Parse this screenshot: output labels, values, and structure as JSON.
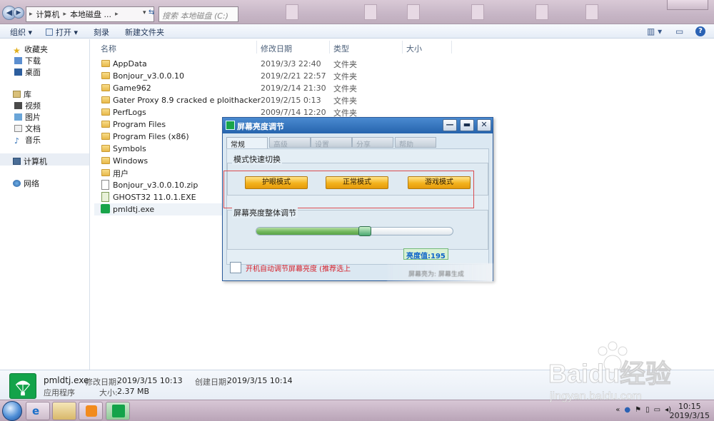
{
  "explorer": {
    "address_parts": [
      "计算机",
      "本地磁盘 ..."
    ],
    "search_placeholder": "搜索 本地磁盘 (C:)",
    "toolbar": {
      "organize": "组织 ▾",
      "open": "打开 ▾",
      "burn": "刻录",
      "new_folder": "新建文件夹"
    },
    "sidebar": {
      "favorites": "收藏夹",
      "downloads": "下载",
      "desktop": "桌面",
      "libraries": "库",
      "videos": "视频",
      "pictures": "图片",
      "documents": "文档",
      "music": "音乐",
      "computer": "计算机",
      "network": "网络"
    },
    "columns": {
      "name": "名称",
      "date": "修改日期",
      "type": "类型",
      "size": "大小"
    },
    "files": [
      {
        "name": "AppData",
        "date": "2019/3/3 22:40",
        "type": "文件夹"
      },
      {
        "name": "Bonjour_v3.0.0.10",
        "date": "2019/2/21 22:57",
        "type": "文件夹"
      },
      {
        "name": "Game962",
        "date": "2019/2/14 21:30",
        "type": "文件夹"
      },
      {
        "name": "Gater Proxy 8.9 cracked e ploithacker",
        "date": "2019/2/15 0:13",
        "type": "文件夹"
      },
      {
        "name": "PerfLogs",
        "date": "2009/7/14 12:20",
        "type": "文件夹"
      },
      {
        "name": "Program Files",
        "date": "",
        "type": ""
      },
      {
        "name": "Program Files (x86)",
        "date": "",
        "type": ""
      },
      {
        "name": "Symbols",
        "date": "",
        "type": ""
      },
      {
        "name": "Windows",
        "date": "",
        "type": ""
      },
      {
        "name": "用户",
        "date": "",
        "type": ""
      },
      {
        "name": "Bonjour_v3.0.0.10.zip",
        "date": "",
        "type": ""
      },
      {
        "name": "GHOST32 11.0.1.EXE",
        "date": "",
        "type": ""
      },
      {
        "name": "pmldtj.exe",
        "date": "",
        "type": ""
      }
    ],
    "details": {
      "filename": "pmldtj.exe",
      "modified_label": "修改日期:",
      "modified": "2019/3/15 10:13",
      "created_label": "创建日期:",
      "created": "2019/3/15 10:14",
      "kind": "应用程序",
      "size_label": "大小:",
      "size": "2.37 MB"
    }
  },
  "dialog": {
    "title": "屏幕亮度调节",
    "tabs": [
      "常规",
      "高级",
      "设置",
      "分享",
      "帮助"
    ],
    "mode_group": "模式快速切换",
    "modes": [
      "护眼模式",
      "正常模式",
      "游戏模式"
    ],
    "brightness_group": "屏幕亮度整体调节",
    "brightness_value_text": "亮度值:195",
    "brightness_fraction": 0.52,
    "autostart_label": "开机自动调节屏幕亮度 (推荐选上",
    "footer_text": "屏幕亮为: 屏幕生成"
  },
  "taskbar": {
    "time": "10:15",
    "date": "2019/3/15"
  },
  "watermark": {
    "brand": "Baidu经验",
    "url": "jingyan.baidu.com"
  }
}
